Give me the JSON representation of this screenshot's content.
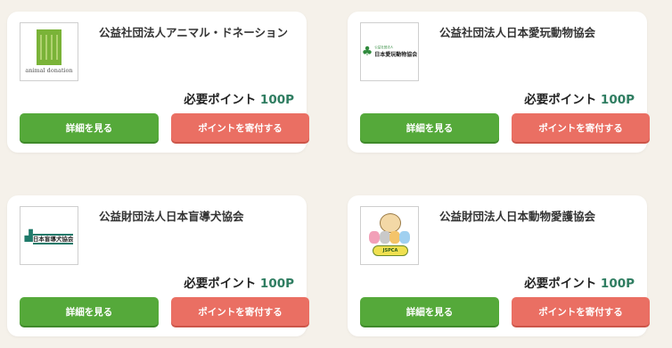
{
  "cards": [
    {
      "name": "公益社団法人アニマル・ドネーション",
      "points_label": "必要ポイント",
      "points_value": "100P",
      "detail_label": "詳細を見る",
      "donate_label": "ポイントを寄付する",
      "logo_text": "animal donation"
    },
    {
      "name": "公益社団法人日本愛玩動物協会",
      "points_label": "必要ポイント",
      "points_value": "100P",
      "detail_label": "詳細を見る",
      "donate_label": "ポイントを寄付する",
      "logo_small": "公益社団法人",
      "logo_text": "日本愛玩動物協会"
    },
    {
      "name": "公益財団法人日本盲導犬協会",
      "points_label": "必要ポイント",
      "points_value": "100P",
      "detail_label": "詳細を見る",
      "donate_label": "ポイントを寄付する",
      "logo_text": "日本盲導犬協会"
    },
    {
      "name": "公益財団法人日本動物愛護協会",
      "points_label": "必要ポイント",
      "points_value": "100P",
      "detail_label": "詳細を見る",
      "donate_label": "ポイントを寄付する",
      "logo_text": "JSPCA"
    }
  ],
  "colors": {
    "detail_button": "#55a93a",
    "donate_button": "#ea6f63",
    "points_value": "#2f7d61",
    "background": "#f5f1ea"
  }
}
